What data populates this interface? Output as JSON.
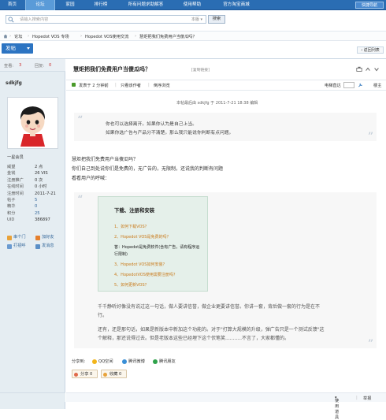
{
  "topnav": {
    "items": [
      "首页",
      "论坛",
      "家园",
      "排行榜",
      "所有问题求助解答",
      "使用帮助",
      "官方淘宝商城"
    ],
    "active_index": 1,
    "quicknav_label": "快捷导航"
  },
  "search": {
    "placeholder": "请输入搜索内容",
    "scope": "本版",
    "button": "搜索"
  },
  "breadcrumb": {
    "items": [
      "论坛",
      "Hopedot VOS 专场",
      "Hopedot VOS使用交流",
      "慧炬把我们免费用户当傻瓜吗？"
    ]
  },
  "actions": {
    "post_button": "发帖",
    "back_button": "返回列表"
  },
  "author": {
    "views_label": "查看:",
    "views": "3",
    "replies_label": "回复:",
    "replies": "0",
    "username": "sdkjfg",
    "level": "一星会员",
    "info": [
      {
        "k": "威望",
        "v": "2 点"
      },
      {
        "k": "金钱",
        "v": "26 VIS"
      },
      {
        "k": "注册推广",
        "v": "0 次"
      },
      {
        "k": "在线时间",
        "v": "0 小时"
      },
      {
        "k": "注册时间",
        "v": "2011-7-21"
      },
      {
        "k": "帖子",
        "v": "5"
      },
      {
        "k": "精华",
        "v": "0"
      },
      {
        "k": "积分",
        "v": "25"
      },
      {
        "k": "UID",
        "v": "386897"
      }
    ],
    "links": [
      "串个门",
      "加好友",
      "打招呼",
      "发消息"
    ]
  },
  "post": {
    "title": "慧炬把我们免费用户当傻瓜吗？",
    "copy_link": "[复制链接]",
    "meta_time": "发表于 2 分钟前",
    "meta_author_only": "只看该作者",
    "meta_reverse": "倒序浏览",
    "electric_label": "电梯直达",
    "floor": "楼主",
    "edit_note": "本帖最后由 sdkjfg 于 2011-7-21 18:38 编辑",
    "quote_lines": [
      "你也可以选择离开。如果你认为是自己上当。",
      "如果你选广告与产品分不清楚。那么我只能说你判断有点问题。"
    ],
    "body_lines": [
      "慧炬把我们免费用户当傻瓜吗？",
      "你们自己到处说你们是免费的，无广告的，无限制，还说我的判断有问题",
      "看看用户的呼喊："
    ],
    "panel_title": "下载、注册和安装",
    "panel_lines": [
      "1、如何下载VOS？",
      "2、Hopedot VOS是免费的吗？",
      "答：Hopedot是免费软件(含有广告，请有程序运",
      "行限制)",
      "3、Hopedot VOS如何安装？",
      "4、HopedotVOS使用需要注册吗？",
      "5、如何更新VOS？"
    ],
    "quote2_lines": [
      "千千静听好像没有说过这一句话，做人要讲信誉，做企业更要讲信誉。你讲一套，背后做一套的行为是在不",
      "行。",
      "还有，还是那句话，如果是新版本中新加这个功能的。对于\"打算大规模的升级，弹广告只是一个测试反馈\"这",
      "个解释，那还说得过去。但是老版本这些已经埋下这个伏笔笑...........不言了，大家都懂的。"
    ],
    "share_label": "分享到:",
    "share_targets": [
      "QQ空间",
      "腾讯微博",
      "腾讯朋友"
    ],
    "share_button": "分享",
    "share_count": "0",
    "fav_button": "收藏",
    "fav_count": "0",
    "tools": "使用道具",
    "report": "举报"
  }
}
